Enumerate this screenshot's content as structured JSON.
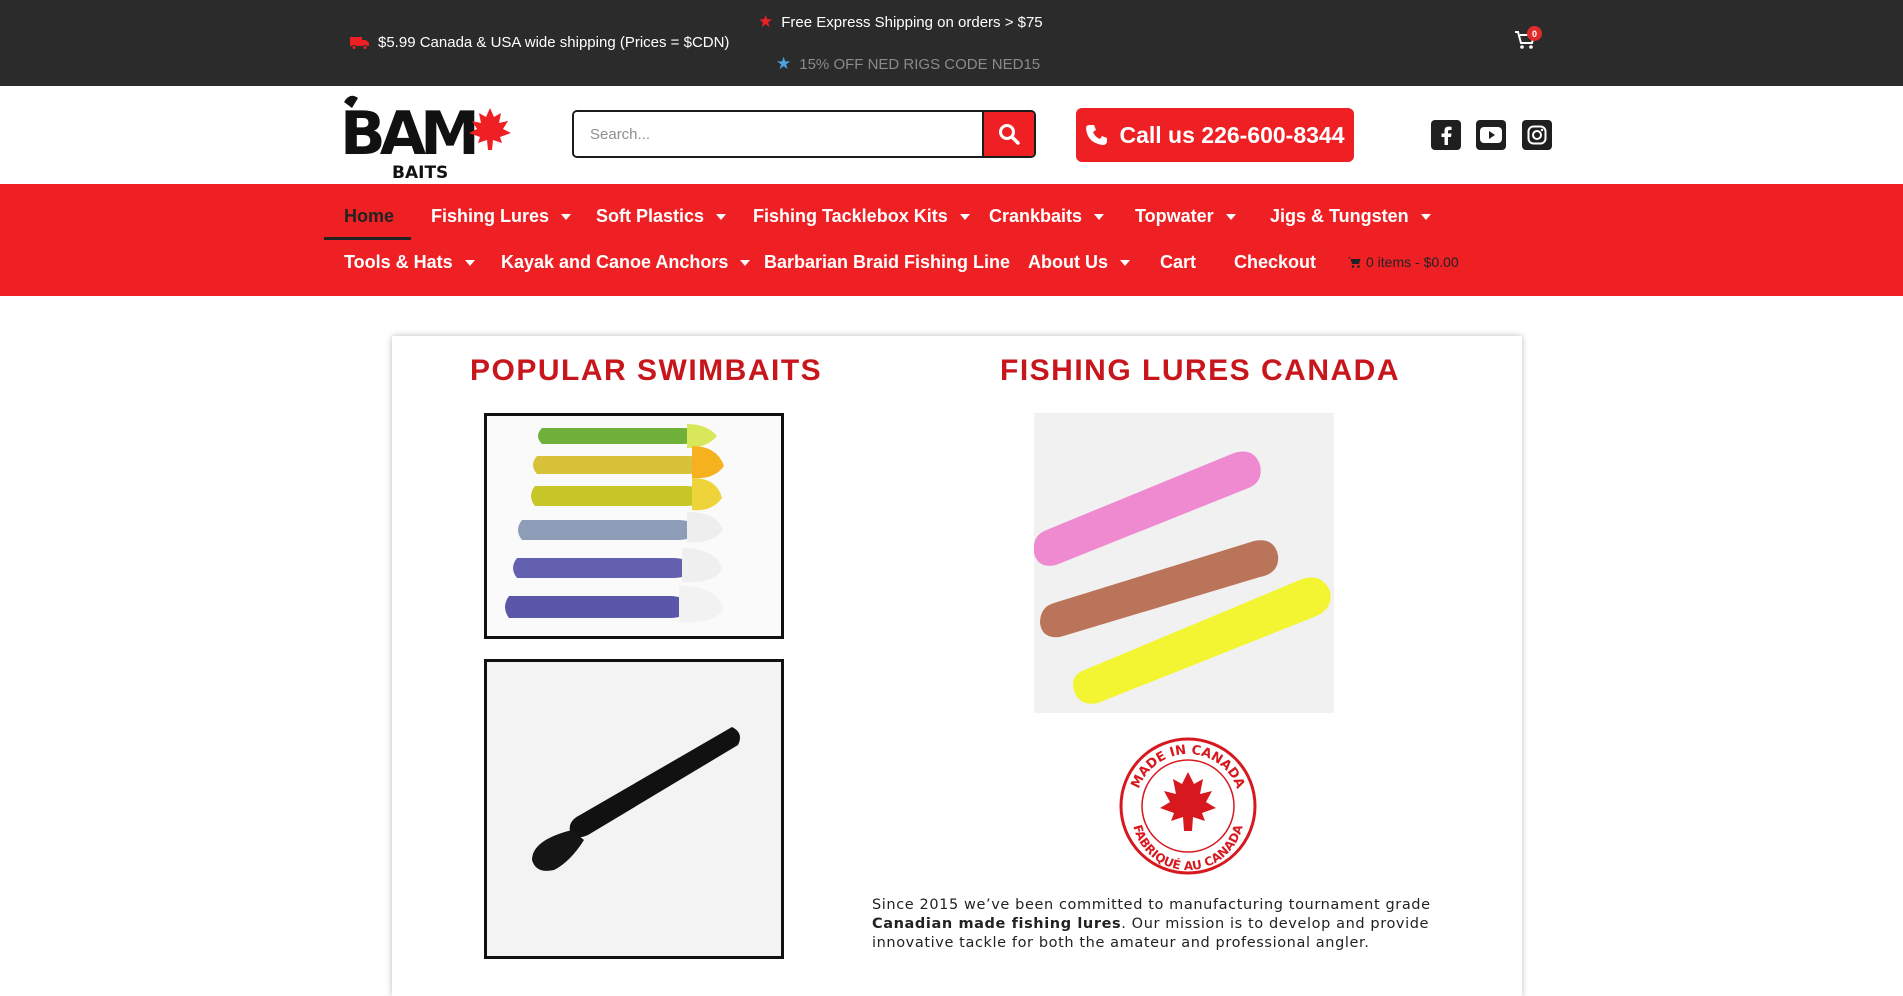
{
  "top_bar": {
    "shipping_text": "$5.99 Canada & USA wide shipping (Prices = $CDN)",
    "express_text": "Free Express Shipping on orders > $75",
    "promo_text": "15% OFF NED RIGS CODE NED15",
    "cart_count": "0"
  },
  "header": {
    "logo_text": "BAM",
    "logo_sub": "BAITS",
    "search_placeholder": "Search...",
    "call_label": "Call us 226-600-8344"
  },
  "nav": {
    "row1": [
      {
        "label": "Home",
        "active": true,
        "dropdown": false
      },
      {
        "label": "Fishing Lures",
        "dropdown": true
      },
      {
        "label": "Soft Plastics",
        "dropdown": true
      },
      {
        "label": "Fishing Tacklebox Kits",
        "dropdown": true
      },
      {
        "label": "Crankbaits",
        "dropdown": true
      },
      {
        "label": "Topwater",
        "dropdown": true
      },
      {
        "label": "Jigs & Tungsten",
        "dropdown": true
      }
    ],
    "row2": [
      {
        "label": "Tools & Hats",
        "dropdown": true
      },
      {
        "label": "Kayak and Canoe Anchors",
        "dropdown": true
      },
      {
        "label": "Barbarian Braid Fishing Line",
        "dropdown": false
      },
      {
        "label": "About Us",
        "dropdown": true
      },
      {
        "label": "Cart",
        "dropdown": false
      },
      {
        "label": "Checkout",
        "dropdown": false
      }
    ],
    "cart_summary": "0 items - $0.00"
  },
  "content": {
    "left_title": "POPULAR SWIMBAITS",
    "right_title": "FISHING LURES CANADA",
    "badge_top": "MADE IN CANADA",
    "badge_bottom": "FABRIQUÉ AU CANADA",
    "intro_part1": "Since 2015 we’ve been committed to manufacturing tournament grade ",
    "intro_bold": "Canadian made fishing lures",
    "intro_part2": ". Our mission is to develop and provide innovative tackle for both the amateur and professional angler."
  },
  "colors": {
    "brand_red": "#ee2024",
    "title_red": "#c8161d",
    "top_bar": "#2b2b2b"
  }
}
